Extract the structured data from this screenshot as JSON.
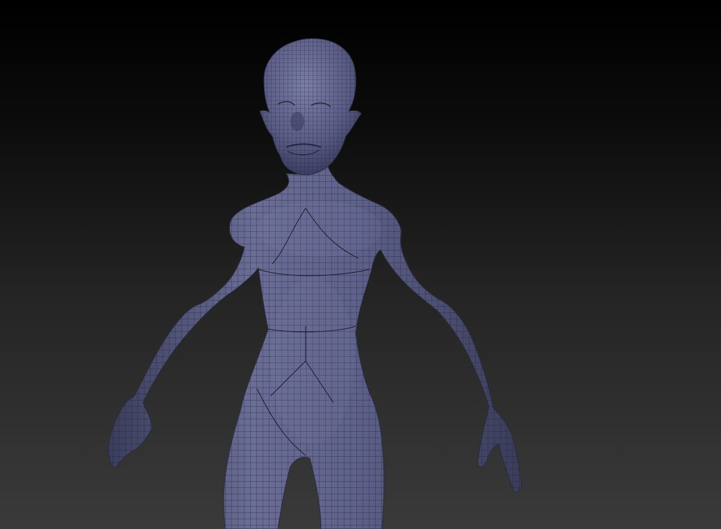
{
  "viewport": {
    "background_top": "#000000",
    "background_bottom": "#3a3a3a",
    "model": {
      "subject": "humanoid-character-sculpt",
      "display": "polyframe-wireframe-overlay",
      "material_color": "#5c5f86",
      "wire_color": "#1e1e2e"
    }
  }
}
